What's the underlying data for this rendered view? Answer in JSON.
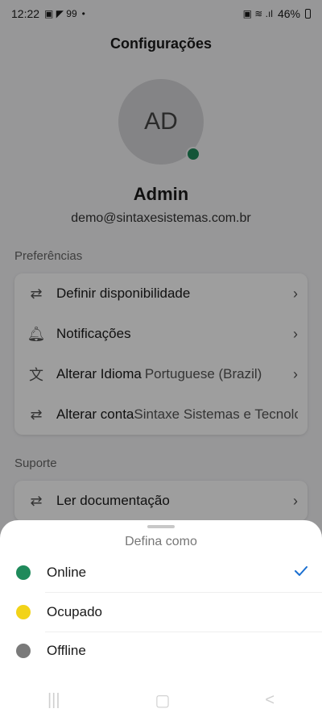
{
  "status_bar": {
    "time": "12:22",
    "left_icons": "▣ ◤ 99",
    "dot": "•",
    "right_icons": "▣ ≋ .ıl",
    "battery": "46%"
  },
  "header": {
    "title": "Configurações"
  },
  "profile": {
    "initials": "AD",
    "status_color": "#1f8a5b",
    "name": "Admin",
    "email": "demo@sintaxesistemas.com.br"
  },
  "preferences": {
    "label": "Preferências",
    "items": [
      {
        "icon": "swap-arrows-icon",
        "label": "Definir disponibilidade",
        "value": ""
      },
      {
        "icon": "bell-icon",
        "label": "Notificações",
        "value": ""
      },
      {
        "icon": "translate-icon",
        "label": "Alterar Idioma",
        "value": "Portuguese (Brazil)"
      },
      {
        "icon": "swap-arrows-icon",
        "label": "Alterar conta",
        "value": "Sintaxe Sistemas e Tecnolo"
      }
    ]
  },
  "support": {
    "label": "Suporte",
    "items": [
      {
        "icon": "swap-arrows-icon",
        "label": "Ler documentação"
      }
    ]
  },
  "sheet": {
    "title": "Defina como",
    "options": [
      {
        "label": "Online",
        "color": "#1f8a5b",
        "selected": true
      },
      {
        "label": "Ocupado",
        "color": "#f2d318",
        "selected": false
      },
      {
        "label": "Offline",
        "color": "#7a7a7a",
        "selected": false
      }
    ],
    "check_color": "#1a6fd1"
  },
  "nav": {
    "recents": "|||",
    "home": "▢",
    "back": "<"
  }
}
